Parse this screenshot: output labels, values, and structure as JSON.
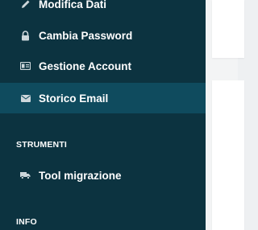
{
  "sidebar": {
    "items": [
      {
        "label": "Modifica Dati",
        "icon": "pencil-icon",
        "active": false
      },
      {
        "label": "Cambia Password",
        "icon": "lock-icon",
        "active": false
      },
      {
        "label": "Gestione Account",
        "icon": "id-card-icon",
        "active": false
      },
      {
        "label": "Storico Email",
        "icon": "envelope-icon",
        "active": true
      }
    ],
    "sections": {
      "strumenti": {
        "title": "STRUMENTI",
        "items": [
          {
            "label": "Tool migrazione",
            "icon": "truck-icon"
          }
        ]
      },
      "info": {
        "title": "INFO"
      }
    }
  },
  "colors": {
    "sidebar_bg": "#0c3340",
    "active_bg": "#0f4b5e",
    "text": "#ffffff",
    "icon": "#cdd7db",
    "content_bg": "#f3f4f5"
  }
}
